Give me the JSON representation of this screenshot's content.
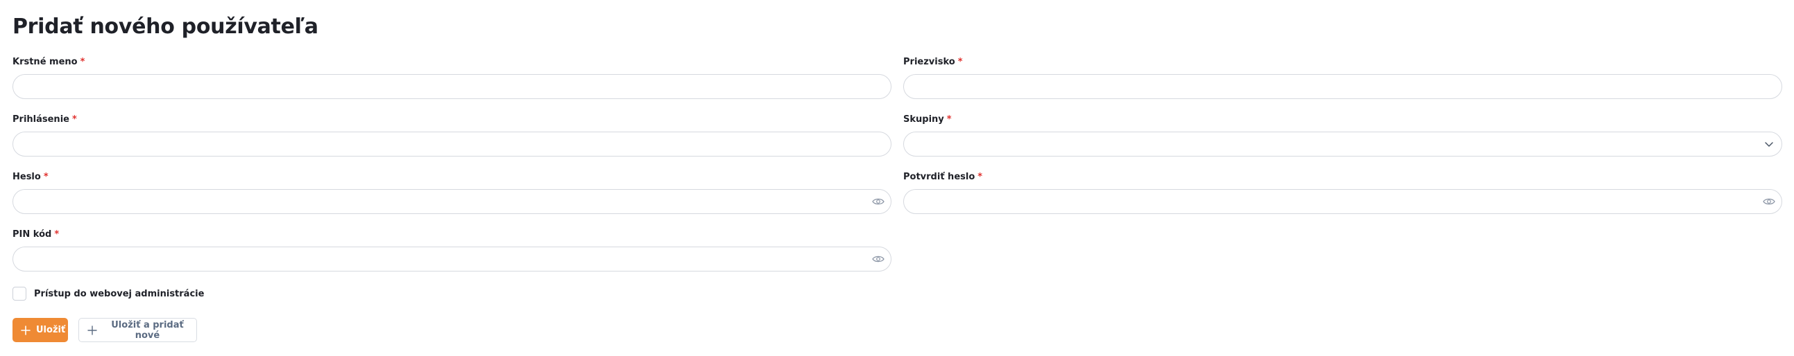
{
  "page": {
    "title": "Pridať nového používateľa"
  },
  "form": {
    "required_marker": "*",
    "first_name": {
      "label": "Krstné meno",
      "value": "",
      "placeholder": ""
    },
    "last_name": {
      "label": "Priezvisko",
      "value": "",
      "placeholder": ""
    },
    "login": {
      "label": "Prihlásenie",
      "value": "",
      "placeholder": ""
    },
    "groups": {
      "label": "Skupiny",
      "selected": ""
    },
    "password": {
      "label": "Heslo",
      "value": "",
      "placeholder": ""
    },
    "confirm_password": {
      "label": "Potvrdiť heslo",
      "value": "",
      "placeholder": ""
    },
    "pin": {
      "label": "PIN kód",
      "value": "",
      "placeholder": ""
    },
    "web_admin_access": {
      "label": "Prístup do webovej administrácie",
      "checked": false
    }
  },
  "actions": {
    "save_label": "Uložiť",
    "save_and_new_label": "Uložiť a pridať nové"
  },
  "colors": {
    "accent": "#ef8a34",
    "required": "#e0322f",
    "border": "#d6d9df",
    "text": "#1f2128",
    "secondary_text": "#5b6b82"
  },
  "icons": {
    "password_toggle": "eye-icon",
    "select_caret": "chevron-down-icon",
    "button_add": "plus-icon"
  }
}
